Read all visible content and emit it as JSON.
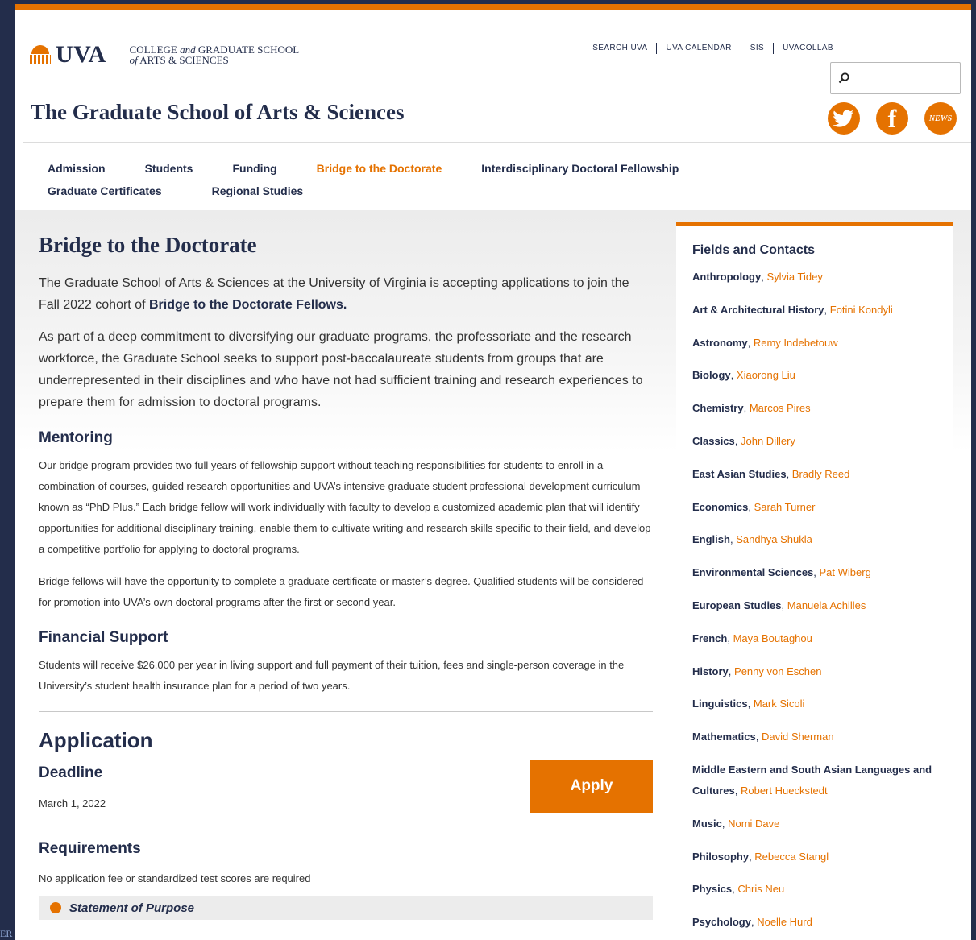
{
  "header": {
    "logo_text": "UVA",
    "college_line1_a": "COLLEGE ",
    "college_line1_and": "and",
    "college_line1_b": " GRADUATE SCHOOL",
    "college_line2_of": "of",
    "college_line2_b": " ARTS & SCIENCES",
    "util_links": [
      "SEARCH UVA",
      "UVA CALENDAR",
      "SIS",
      "UVACOLLAB"
    ],
    "search_placeholder": "",
    "site_title": "The Graduate School of Arts & Sciences",
    "social": {
      "news_label": "NEWS"
    }
  },
  "nav": {
    "items": [
      "Admission",
      "Students",
      "Funding",
      "Bridge to the Doctorate",
      "Interdisciplinary Doctoral Fellowship",
      "Graduate Certificates",
      "Regional Studies"
    ],
    "active": "Bridge to the Doctorate"
  },
  "main": {
    "title": "Bridge to the Doctorate",
    "intro_a": "The Graduate School of Arts & Sciences at the University of Virginia is accepting applications to join the Fall 2022 cohort of ",
    "intro_bold": "Bridge to the Doctorate Fellows.",
    "intro2": "As part of a deep commitment to diversifying our graduate programs, the professoriate and the research workforce, the Graduate School seeks to support post-baccalaureate students from groups that are underrepresented in their disciplines and who have not had sufficient training and research experiences to prepare them for admission to doctoral programs.",
    "mentoring_title": "Mentoring",
    "mentoring_p1": "Our bridge program provides two full years of fellowship support without teaching responsibilities for students to enroll in a combination of courses, guided research opportunities and UVA’s intensive graduate student professional development curriculum known as “PhD Plus.” Each bridge fellow will work individually with faculty to develop a customized academic plan that will identify opportunities for additional disciplinary training, enable them to cultivate writing and research skills specific to their field, and develop a competitive portfolio for applying to doctoral programs.",
    "mentoring_p2": "Bridge fellows will have the opportunity to complete a graduate certificate or master’s degree. Qualified students will be considered for promotion into UVA’s own doctoral programs after the first or second year.",
    "financial_title": "Financial Support",
    "financial_p": "Students will receive $26,000 per year in living support and full payment of their tuition, fees and single-person coverage in the University’s student health insurance plan for a period of two years.",
    "application_title": "Application",
    "deadline_title": "Deadline",
    "deadline_date": "March 1, 2022",
    "apply_label": "Apply",
    "requirements_title": "Requirements",
    "requirements_text": "No application fee or standardized test scores are required",
    "accordion_first": "Statement of Purpose"
  },
  "sidebar": {
    "title": "Fields and Contacts",
    "contacts": [
      {
        "field": "Anthropology",
        "person": "Sylvia Tidey"
      },
      {
        "field": "Art & Architectural History",
        "person": "Fotini Kondyli"
      },
      {
        "field": "Astronomy",
        "person": "Remy Indebetouw"
      },
      {
        "field": "Biology",
        "person": "Xiaorong Liu"
      },
      {
        "field": "Chemistry",
        "person": "Marcos Pires"
      },
      {
        "field": "Classics",
        "person": "John Dillery"
      },
      {
        "field": "East Asian Studies",
        "person": "Bradly Reed"
      },
      {
        "field": "Economics",
        "person": "Sarah Turner"
      },
      {
        "field": "English",
        "person": "Sandhya Shukla"
      },
      {
        "field": "Environmental Sciences",
        "person": "Pat Wiberg"
      },
      {
        "field": "European Studies",
        "person": "Manuela Achilles"
      },
      {
        "field": "French",
        "person": "Maya Boutaghou"
      },
      {
        "field": "History",
        "person": "Penny von Eschen"
      },
      {
        "field": "Linguistics",
        "person": "Mark Sicoli"
      },
      {
        "field": "Mathematics",
        "person": "David Sherman"
      },
      {
        "field": "Middle Eastern and South Asian Languages and Cultures",
        "person": "Robert Hueckstedt"
      },
      {
        "field": "Music",
        "person": "Nomi Dave"
      },
      {
        "field": "Philosophy",
        "person": "Rebecca Stangl"
      },
      {
        "field": "Physics",
        "person": "Chris Neu"
      },
      {
        "field": "Psychology",
        "person": "Noelle Hurd"
      }
    ]
  },
  "edge_tag": "ER",
  "colors": {
    "orange": "#e57200",
    "navy": "#232d4b",
    "page_bg": "#232d4b"
  }
}
